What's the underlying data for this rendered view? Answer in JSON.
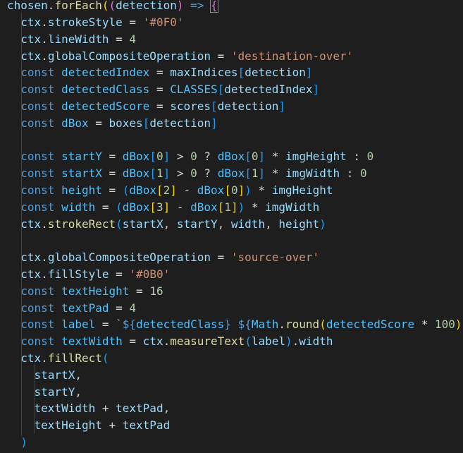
{
  "editor": {
    "language": "javascript",
    "theme": "dark",
    "lines": [
      {
        "tokens": [
          [
            "variable",
            "chosen"
          ],
          [
            "plain",
            "."
          ],
          [
            "function",
            "forEach"
          ],
          [
            "bracket1",
            "("
          ],
          [
            "bracket2",
            "("
          ],
          [
            "variable",
            "detection"
          ],
          [
            "bracket2",
            ")"
          ],
          [
            "plain",
            " "
          ],
          [
            "keyword",
            "=>"
          ],
          [
            "plain",
            " "
          ],
          [
            "bracket2_match",
            "{"
          ]
        ]
      },
      {
        "tokens": [
          [
            "plain",
            "  "
          ],
          [
            "variable",
            "ctx"
          ],
          [
            "plain",
            "."
          ],
          [
            "variable",
            "strokeStyle"
          ],
          [
            "plain",
            " = "
          ],
          [
            "string",
            "'#0F0'"
          ]
        ]
      },
      {
        "tokens": [
          [
            "plain",
            "  "
          ],
          [
            "variable",
            "ctx"
          ],
          [
            "plain",
            "."
          ],
          [
            "variable",
            "lineWidth"
          ],
          [
            "plain",
            " = "
          ],
          [
            "number",
            "4"
          ]
        ]
      },
      {
        "tokens": [
          [
            "plain",
            "  "
          ],
          [
            "variable",
            "ctx"
          ],
          [
            "plain",
            "."
          ],
          [
            "variable",
            "globalCompositeOperation"
          ],
          [
            "plain",
            " = "
          ],
          [
            "string",
            "'destination-over'"
          ]
        ]
      },
      {
        "tokens": [
          [
            "plain",
            "  "
          ],
          [
            "keyword",
            "const"
          ],
          [
            "plain",
            " "
          ],
          [
            "constant",
            "detectedIndex"
          ],
          [
            "plain",
            " = "
          ],
          [
            "variable",
            "maxIndices"
          ],
          [
            "bracket3",
            "["
          ],
          [
            "variable",
            "detection"
          ],
          [
            "bracket3",
            "]"
          ]
        ]
      },
      {
        "tokens": [
          [
            "plain",
            "  "
          ],
          [
            "keyword",
            "const"
          ],
          [
            "plain",
            " "
          ],
          [
            "constant",
            "detectedClass"
          ],
          [
            "plain",
            " = "
          ],
          [
            "constant",
            "CLASSES"
          ],
          [
            "bracket3",
            "["
          ],
          [
            "variable",
            "detectedIndex"
          ],
          [
            "bracket3",
            "]"
          ]
        ]
      },
      {
        "tokens": [
          [
            "plain",
            "  "
          ],
          [
            "keyword",
            "const"
          ],
          [
            "plain",
            " "
          ],
          [
            "constant",
            "detectedScore"
          ],
          [
            "plain",
            " = "
          ],
          [
            "variable",
            "scores"
          ],
          [
            "bracket3",
            "["
          ],
          [
            "variable",
            "detection"
          ],
          [
            "bracket3",
            "]"
          ]
        ]
      },
      {
        "tokens": [
          [
            "plain",
            "  "
          ],
          [
            "keyword",
            "const"
          ],
          [
            "plain",
            " "
          ],
          [
            "constant",
            "dBox"
          ],
          [
            "plain",
            " = "
          ],
          [
            "variable",
            "boxes"
          ],
          [
            "bracket3",
            "["
          ],
          [
            "variable",
            "detection"
          ],
          [
            "bracket3",
            "]"
          ]
        ]
      },
      {
        "tokens": []
      },
      {
        "tokens": [
          [
            "plain",
            "  "
          ],
          [
            "keyword",
            "const"
          ],
          [
            "plain",
            " "
          ],
          [
            "constant",
            "startY"
          ],
          [
            "plain",
            " = "
          ],
          [
            "constant",
            "dBox"
          ],
          [
            "bracket3",
            "["
          ],
          [
            "number",
            "0"
          ],
          [
            "bracket3",
            "]"
          ],
          [
            "plain",
            " > "
          ],
          [
            "number",
            "0"
          ],
          [
            "plain",
            " ? "
          ],
          [
            "constant",
            "dBox"
          ],
          [
            "bracket3",
            "["
          ],
          [
            "number",
            "0"
          ],
          [
            "bracket3",
            "]"
          ],
          [
            "plain",
            " * "
          ],
          [
            "variable",
            "imgHeight"
          ],
          [
            "plain",
            " : "
          ],
          [
            "number",
            "0"
          ]
        ]
      },
      {
        "tokens": [
          [
            "plain",
            "  "
          ],
          [
            "keyword",
            "const"
          ],
          [
            "plain",
            " "
          ],
          [
            "constant",
            "startX"
          ],
          [
            "plain",
            " = "
          ],
          [
            "constant",
            "dBox"
          ],
          [
            "bracket3",
            "["
          ],
          [
            "number",
            "1"
          ],
          [
            "bracket3",
            "]"
          ],
          [
            "plain",
            " > "
          ],
          [
            "number",
            "0"
          ],
          [
            "plain",
            " ? "
          ],
          [
            "constant",
            "dBox"
          ],
          [
            "bracket3",
            "["
          ],
          [
            "number",
            "1"
          ],
          [
            "bracket3",
            "]"
          ],
          [
            "plain",
            " * "
          ],
          [
            "variable",
            "imgWidth"
          ],
          [
            "plain",
            " : "
          ],
          [
            "number",
            "0"
          ]
        ]
      },
      {
        "tokens": [
          [
            "plain",
            "  "
          ],
          [
            "keyword",
            "const"
          ],
          [
            "plain",
            " "
          ],
          [
            "constant",
            "height"
          ],
          [
            "plain",
            " = "
          ],
          [
            "bracket3",
            "("
          ],
          [
            "constant",
            "dBox"
          ],
          [
            "bracket1",
            "["
          ],
          [
            "number",
            "2"
          ],
          [
            "bracket1",
            "]"
          ],
          [
            "plain",
            " - "
          ],
          [
            "constant",
            "dBox"
          ],
          [
            "bracket1",
            "["
          ],
          [
            "number",
            "0"
          ],
          [
            "bracket1",
            "]"
          ],
          [
            "bracket3",
            ")"
          ],
          [
            "plain",
            " * "
          ],
          [
            "variable",
            "imgHeight"
          ]
        ]
      },
      {
        "tokens": [
          [
            "plain",
            "  "
          ],
          [
            "keyword",
            "const"
          ],
          [
            "plain",
            " "
          ],
          [
            "constant",
            "width"
          ],
          [
            "plain",
            " = "
          ],
          [
            "bracket3",
            "("
          ],
          [
            "constant",
            "dBox"
          ],
          [
            "bracket1",
            "["
          ],
          [
            "number",
            "3"
          ],
          [
            "bracket1",
            "]"
          ],
          [
            "plain",
            " - "
          ],
          [
            "constant",
            "dBox"
          ],
          [
            "bracket1",
            "["
          ],
          [
            "number",
            "1"
          ],
          [
            "bracket1",
            "]"
          ],
          [
            "bracket3",
            ")"
          ],
          [
            "plain",
            " * "
          ],
          [
            "variable",
            "imgWidth"
          ]
        ]
      },
      {
        "tokens": [
          [
            "plain",
            "  "
          ],
          [
            "variable",
            "ctx"
          ],
          [
            "plain",
            "."
          ],
          [
            "function",
            "strokeRect"
          ],
          [
            "bracket3",
            "("
          ],
          [
            "variable",
            "startX"
          ],
          [
            "plain",
            ", "
          ],
          [
            "variable",
            "startY"
          ],
          [
            "plain",
            ", "
          ],
          [
            "variable",
            "width"
          ],
          [
            "plain",
            ", "
          ],
          [
            "variable",
            "height"
          ],
          [
            "bracket3",
            ")"
          ]
        ]
      },
      {
        "tokens": []
      },
      {
        "tokens": [
          [
            "plain",
            "  "
          ],
          [
            "variable",
            "ctx"
          ],
          [
            "plain",
            "."
          ],
          [
            "variable",
            "globalCompositeOperation"
          ],
          [
            "plain",
            " = "
          ],
          [
            "string",
            "'source-over'"
          ]
        ]
      },
      {
        "tokens": [
          [
            "plain",
            "  "
          ],
          [
            "variable",
            "ctx"
          ],
          [
            "plain",
            "."
          ],
          [
            "variable",
            "fillStyle"
          ],
          [
            "plain",
            " = "
          ],
          [
            "string",
            "'#0B0'"
          ]
        ]
      },
      {
        "tokens": [
          [
            "plain",
            "  "
          ],
          [
            "keyword",
            "const"
          ],
          [
            "plain",
            " "
          ],
          [
            "constant",
            "textHeight"
          ],
          [
            "plain",
            " = "
          ],
          [
            "number",
            "16"
          ]
        ]
      },
      {
        "tokens": [
          [
            "plain",
            "  "
          ],
          [
            "keyword",
            "const"
          ],
          [
            "plain",
            " "
          ],
          [
            "constant",
            "textPad"
          ],
          [
            "plain",
            " = "
          ],
          [
            "number",
            "4"
          ]
        ]
      },
      {
        "tokens": [
          [
            "plain",
            "  "
          ],
          [
            "keyword",
            "const"
          ],
          [
            "plain",
            " "
          ],
          [
            "constant",
            "label"
          ],
          [
            "plain",
            " = "
          ],
          [
            "string",
            "`"
          ],
          [
            "keyword",
            "${"
          ],
          [
            "constant",
            "detectedClass"
          ],
          [
            "keyword",
            "}"
          ],
          [
            "string",
            " "
          ],
          [
            "keyword",
            "${"
          ],
          [
            "constant",
            "Math"
          ],
          [
            "plain",
            "."
          ],
          [
            "function",
            "round"
          ],
          [
            "bracket1",
            "("
          ],
          [
            "constant",
            "detectedScore"
          ],
          [
            "plain",
            " * "
          ],
          [
            "number",
            "100"
          ],
          [
            "bracket1",
            ")"
          ]
        ]
      },
      {
        "tokens": [
          [
            "plain",
            "  "
          ],
          [
            "keyword",
            "const"
          ],
          [
            "plain",
            " "
          ],
          [
            "constant",
            "textWidth"
          ],
          [
            "plain",
            " = "
          ],
          [
            "variable",
            "ctx"
          ],
          [
            "plain",
            "."
          ],
          [
            "function",
            "measureText"
          ],
          [
            "bracket3",
            "("
          ],
          [
            "variable",
            "label"
          ],
          [
            "bracket3",
            ")"
          ],
          [
            "plain",
            "."
          ],
          [
            "variable",
            "width"
          ]
        ]
      },
      {
        "tokens": [
          [
            "plain",
            "  "
          ],
          [
            "variable",
            "ctx"
          ],
          [
            "plain",
            "."
          ],
          [
            "function",
            "fillRect"
          ],
          [
            "bracket3",
            "("
          ]
        ]
      },
      {
        "tokens": [
          [
            "plain",
            "    "
          ],
          [
            "variable",
            "startX"
          ],
          [
            "plain",
            ","
          ]
        ]
      },
      {
        "tokens": [
          [
            "plain",
            "    "
          ],
          [
            "variable",
            "startY"
          ],
          [
            "plain",
            ","
          ]
        ]
      },
      {
        "tokens": [
          [
            "plain",
            "    "
          ],
          [
            "variable",
            "textWidth"
          ],
          [
            "plain",
            " + "
          ],
          [
            "variable",
            "textPad"
          ],
          [
            "plain",
            ","
          ]
        ]
      },
      {
        "tokens": [
          [
            "plain",
            "    "
          ],
          [
            "variable",
            "textHeight"
          ],
          [
            "plain",
            " + "
          ],
          [
            "variable",
            "textPad"
          ]
        ]
      },
      {
        "tokens": [
          [
            "plain",
            "  "
          ],
          [
            "bracket3",
            ")"
          ]
        ]
      }
    ]
  }
}
